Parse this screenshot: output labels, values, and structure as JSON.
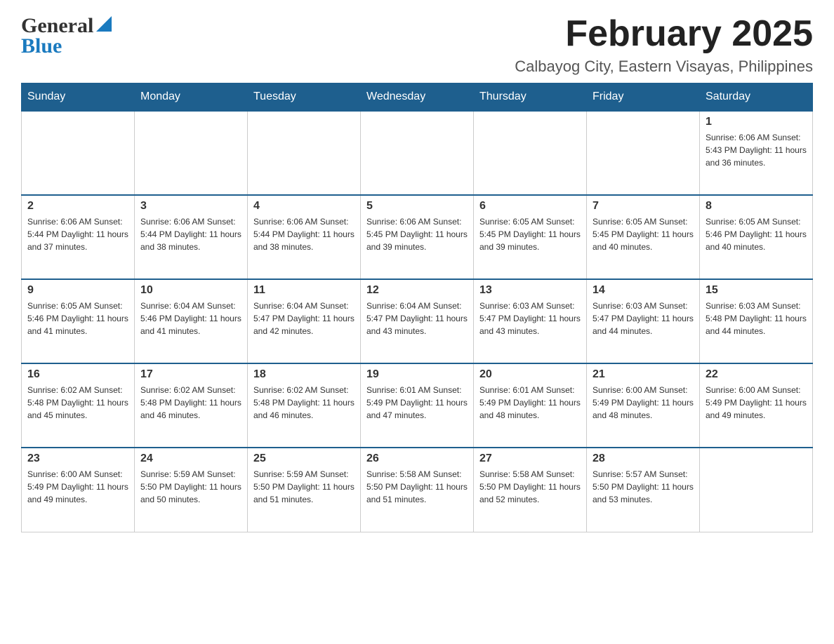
{
  "header": {
    "logo_general": "General",
    "logo_blue": "Blue",
    "title": "February 2025",
    "subtitle": "Calbayog City, Eastern Visayas, Philippines"
  },
  "days_of_week": [
    "Sunday",
    "Monday",
    "Tuesday",
    "Wednesday",
    "Thursday",
    "Friday",
    "Saturday"
  ],
  "weeks": [
    [
      {
        "day": "",
        "info": ""
      },
      {
        "day": "",
        "info": ""
      },
      {
        "day": "",
        "info": ""
      },
      {
        "day": "",
        "info": ""
      },
      {
        "day": "",
        "info": ""
      },
      {
        "day": "",
        "info": ""
      },
      {
        "day": "1",
        "info": "Sunrise: 6:06 AM\nSunset: 5:43 PM\nDaylight: 11 hours and 36 minutes."
      }
    ],
    [
      {
        "day": "2",
        "info": "Sunrise: 6:06 AM\nSunset: 5:44 PM\nDaylight: 11 hours and 37 minutes."
      },
      {
        "day": "3",
        "info": "Sunrise: 6:06 AM\nSunset: 5:44 PM\nDaylight: 11 hours and 38 minutes."
      },
      {
        "day": "4",
        "info": "Sunrise: 6:06 AM\nSunset: 5:44 PM\nDaylight: 11 hours and 38 minutes."
      },
      {
        "day": "5",
        "info": "Sunrise: 6:06 AM\nSunset: 5:45 PM\nDaylight: 11 hours and 39 minutes."
      },
      {
        "day": "6",
        "info": "Sunrise: 6:05 AM\nSunset: 5:45 PM\nDaylight: 11 hours and 39 minutes."
      },
      {
        "day": "7",
        "info": "Sunrise: 6:05 AM\nSunset: 5:45 PM\nDaylight: 11 hours and 40 minutes."
      },
      {
        "day": "8",
        "info": "Sunrise: 6:05 AM\nSunset: 5:46 PM\nDaylight: 11 hours and 40 minutes."
      }
    ],
    [
      {
        "day": "9",
        "info": "Sunrise: 6:05 AM\nSunset: 5:46 PM\nDaylight: 11 hours and 41 minutes."
      },
      {
        "day": "10",
        "info": "Sunrise: 6:04 AM\nSunset: 5:46 PM\nDaylight: 11 hours and 41 minutes."
      },
      {
        "day": "11",
        "info": "Sunrise: 6:04 AM\nSunset: 5:47 PM\nDaylight: 11 hours and 42 minutes."
      },
      {
        "day": "12",
        "info": "Sunrise: 6:04 AM\nSunset: 5:47 PM\nDaylight: 11 hours and 43 minutes."
      },
      {
        "day": "13",
        "info": "Sunrise: 6:03 AM\nSunset: 5:47 PM\nDaylight: 11 hours and 43 minutes."
      },
      {
        "day": "14",
        "info": "Sunrise: 6:03 AM\nSunset: 5:47 PM\nDaylight: 11 hours and 44 minutes."
      },
      {
        "day": "15",
        "info": "Sunrise: 6:03 AM\nSunset: 5:48 PM\nDaylight: 11 hours and 44 minutes."
      }
    ],
    [
      {
        "day": "16",
        "info": "Sunrise: 6:02 AM\nSunset: 5:48 PM\nDaylight: 11 hours and 45 minutes."
      },
      {
        "day": "17",
        "info": "Sunrise: 6:02 AM\nSunset: 5:48 PM\nDaylight: 11 hours and 46 minutes."
      },
      {
        "day": "18",
        "info": "Sunrise: 6:02 AM\nSunset: 5:48 PM\nDaylight: 11 hours and 46 minutes."
      },
      {
        "day": "19",
        "info": "Sunrise: 6:01 AM\nSunset: 5:49 PM\nDaylight: 11 hours and 47 minutes."
      },
      {
        "day": "20",
        "info": "Sunrise: 6:01 AM\nSunset: 5:49 PM\nDaylight: 11 hours and 48 minutes."
      },
      {
        "day": "21",
        "info": "Sunrise: 6:00 AM\nSunset: 5:49 PM\nDaylight: 11 hours and 48 minutes."
      },
      {
        "day": "22",
        "info": "Sunrise: 6:00 AM\nSunset: 5:49 PM\nDaylight: 11 hours and 49 minutes."
      }
    ],
    [
      {
        "day": "23",
        "info": "Sunrise: 6:00 AM\nSunset: 5:49 PM\nDaylight: 11 hours and 49 minutes."
      },
      {
        "day": "24",
        "info": "Sunrise: 5:59 AM\nSunset: 5:50 PM\nDaylight: 11 hours and 50 minutes."
      },
      {
        "day": "25",
        "info": "Sunrise: 5:59 AM\nSunset: 5:50 PM\nDaylight: 11 hours and 51 minutes."
      },
      {
        "day": "26",
        "info": "Sunrise: 5:58 AM\nSunset: 5:50 PM\nDaylight: 11 hours and 51 minutes."
      },
      {
        "day": "27",
        "info": "Sunrise: 5:58 AM\nSunset: 5:50 PM\nDaylight: 11 hours and 52 minutes."
      },
      {
        "day": "28",
        "info": "Sunrise: 5:57 AM\nSunset: 5:50 PM\nDaylight: 11 hours and 53 minutes."
      },
      {
        "day": "",
        "info": ""
      }
    ]
  ]
}
